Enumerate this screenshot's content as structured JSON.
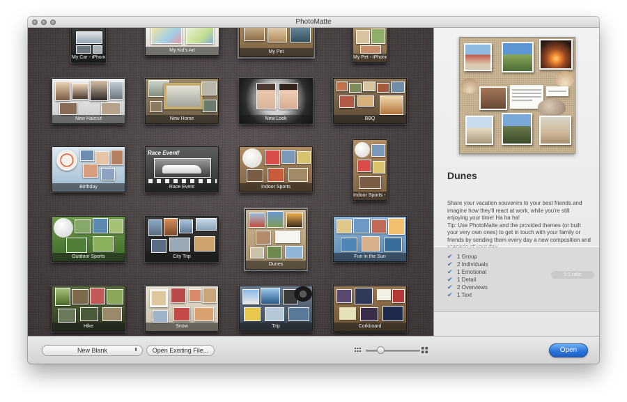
{
  "window": {
    "title": "PhotoMatte"
  },
  "gallery": {
    "themes": [
      {
        "label": "My Car - iPhone"
      },
      {
        "label": "My Kid's Art"
      },
      {
        "label": "My Pet"
      },
      {
        "label": "My Pet - iPhone"
      },
      {
        "label": "New Haircut"
      },
      {
        "label": "New Home"
      },
      {
        "label": "New Look"
      },
      {
        "label": "BBQ"
      },
      {
        "label": "Birthday"
      },
      {
        "label": "Race Event"
      },
      {
        "label": "Indoor Sports"
      },
      {
        "label": "Indoor Sports - iPhone"
      },
      {
        "label": "Outdoor Sports"
      },
      {
        "label": "City Trip"
      },
      {
        "label": "Dunes"
      },
      {
        "label": "Fun in the Sun"
      },
      {
        "label": "Hike"
      },
      {
        "label": "Snow"
      },
      {
        "label": "Trip"
      },
      {
        "label": "Corkboard"
      }
    ],
    "race_event_banner": "Race Event!",
    "selected": "Dunes"
  },
  "preview": {
    "title": "Dunes",
    "description": "Share your vacation souvenirs to your best friends and imagine how they'll react at work, while you're still enjoying your time! Ha ha ha!\nTip: Use PhotoMatte and the provided themes (or built your very own ones) to get in touch with your family or friends by sending them every day a new composition and scenario of your day.",
    "details": [
      {
        "text": "1 Group"
      },
      {
        "text": "2 Individuals"
      },
      {
        "text": "1 Emotional"
      },
      {
        "text": "1 Detail"
      },
      {
        "text": "2 Overviews"
      },
      {
        "text": "1 Text"
      }
    ],
    "ratio": "1:1 ratio"
  },
  "bottombar": {
    "template_select": "New Blank",
    "open_existing_label": "Open Existing File...",
    "zoom_level": 0.28,
    "open_label": "Open"
  },
  "colors": {
    "accent": "#2b74d8",
    "gallery_bg": "#4a4344",
    "check": "#2f6fbf"
  },
  "icons": {
    "traffic_lights": "window-controls-icon",
    "zoom_small": "small-grid-icon",
    "zoom_large": "large-grid-icon",
    "check": "checkmark-icon",
    "popup_arrows": "updown-arrows-icon"
  }
}
